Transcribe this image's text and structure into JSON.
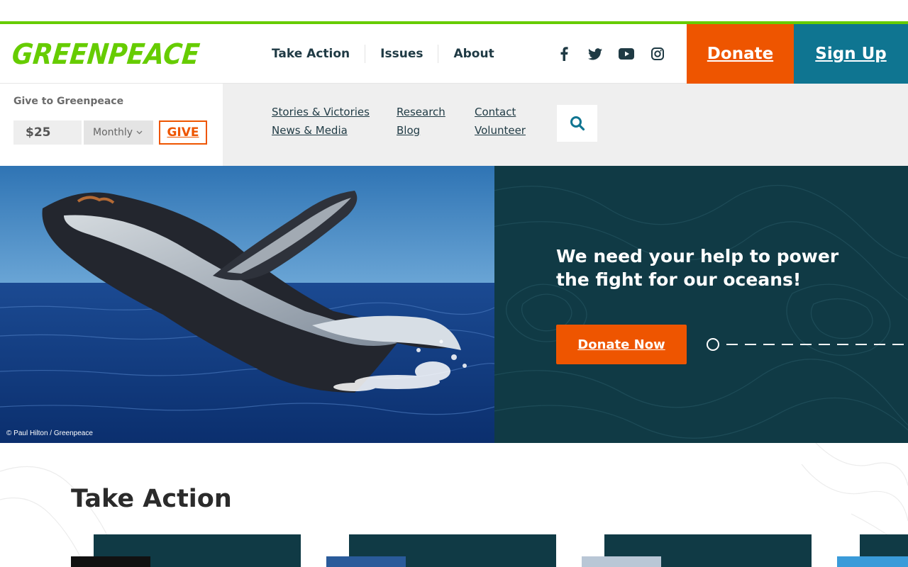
{
  "brand": {
    "logo_text": "GREENPEACE",
    "green": "#66cc00",
    "orange": "#ee5500",
    "teal": "#0f7591",
    "navy": "#103a45"
  },
  "header": {
    "nav": [
      "Take Action",
      "Issues",
      "About"
    ],
    "social_icons": [
      "facebook-icon",
      "twitter-icon",
      "youtube-icon",
      "instagram-icon"
    ],
    "donate_label": "Donate",
    "signup_label": "Sign Up"
  },
  "give": {
    "title": "Give to Greenpeace",
    "amount": "$25",
    "frequency": "Monthly",
    "button": "GIVE"
  },
  "subnav": {
    "col1": [
      "Stories & Victories",
      "News & Media"
    ],
    "col2": [
      "Research",
      "Blog"
    ],
    "col3": [
      "Contact",
      "Volunteer"
    ],
    "search_icon": "search-icon"
  },
  "hero": {
    "credit": "© Paul Hilton / Greenpeace",
    "headline": "We need your help to power the fight for our oceans!",
    "cta": "Donate Now",
    "slides_total": 11,
    "slide_active": 1
  },
  "section": {
    "title": "Take Action"
  }
}
